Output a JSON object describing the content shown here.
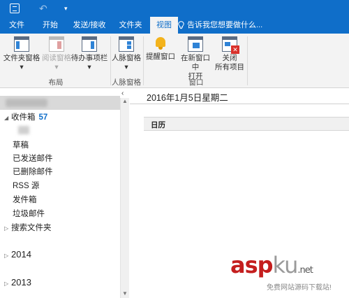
{
  "colors": {
    "accent": "#0f6ec9",
    "ribbon_bg": "#f3f3f3",
    "count": "#0f6ec9",
    "watermark": "#c41e1e"
  },
  "titlebar": {
    "icons": [
      "app-icon",
      "undo-icon",
      "quick-access-dropdown-icon"
    ]
  },
  "tabs": [
    {
      "label": "文件",
      "active": false
    },
    {
      "label": "开始",
      "active": false
    },
    {
      "label": "发送/接收",
      "active": false
    },
    {
      "label": "文件夹",
      "active": false
    },
    {
      "label": "视图",
      "active": true
    }
  ],
  "tell_me": {
    "text": "告诉我您想要做什么...",
    "icon": "lightbulb-icon"
  },
  "ribbon": {
    "folder_pane": "文件夹窗格",
    "reading_pane": "阅读窗格",
    "todo_bar": "待办事项栏",
    "people_pane": "人脉窗格",
    "reminders": "提醒窗口",
    "new_window_line1": "在新窗口中",
    "new_window_line2": "打开",
    "close_all_line1": "关闭",
    "close_all_line2": "所有项目",
    "group_layout": "布局",
    "group_people": "人脉窗格",
    "group_window": "窗口",
    "dropdown": "▾"
  },
  "folders": {
    "inbox": "收件箱",
    "inbox_count": "57",
    "drafts": "草稿",
    "sent": "已发送邮件",
    "deleted": "已删除邮件",
    "rss": "RSS 源",
    "outbox": "发件箱",
    "junk": "垃圾邮件",
    "search": "搜索文件夹",
    "year_2014": "2014",
    "year_2013": "2013"
  },
  "main": {
    "date": "2016年1月5日星期二",
    "calendar_header": "日历"
  },
  "watermark": {
    "asp": "asp",
    "ku": "ku",
    "net": ".net",
    "subtitle": "免费网站源码下载站!"
  }
}
